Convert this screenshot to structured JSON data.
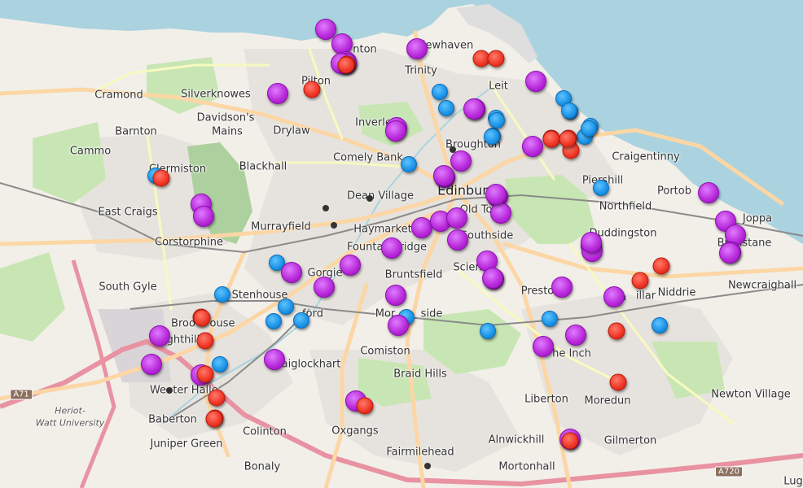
{
  "map": {
    "colors": {
      "land": "#f2efe9",
      "water": "#aad3df",
      "park": "#c8e6b4",
      "residential": "#e0dfdf",
      "primary_road": "#fcd6a4",
      "motorway": "#e892a2",
      "purple_marker": "#b626d8",
      "red_marker": "#ee3424",
      "blue_marker": "#1a92e6"
    },
    "places": [
      {
        "name": "Granton",
        "label": "nton"
      },
      {
        "name": "Newhaven",
        "label": "Newhaven"
      },
      {
        "name": "Cramond",
        "label": "Cramond"
      },
      {
        "name": "Silverknowes",
        "label": "Silverknowes"
      },
      {
        "name": "Pilton",
        "label": "Pilton"
      },
      {
        "name": "Trinity",
        "label": "Trinity"
      },
      {
        "name": "Leith",
        "label": "Leit"
      },
      {
        "name": "Davidson's Mains",
        "label": "Davidson's"
      },
      {
        "name": "Davidson's Mains 2",
        "label": "Mains"
      },
      {
        "name": "Barnton",
        "label": "Barnton"
      },
      {
        "name": "Drylaw",
        "label": "Drylaw"
      },
      {
        "name": "Inverleith",
        "label": "Inverleith"
      },
      {
        "name": "Cammo",
        "label": "Cammo"
      },
      {
        "name": "Broughton",
        "label": "Broughton"
      },
      {
        "name": "Craigentinny",
        "label": "Craigentinny"
      },
      {
        "name": "Comely Bank",
        "label": "Comely Bank"
      },
      {
        "name": "Clermiston",
        "label": "Clermiston"
      },
      {
        "name": "Blackhall",
        "label": "Blackhall"
      },
      {
        "name": "Piershill",
        "label": "Piershill"
      },
      {
        "name": "Dean Village",
        "label": "Dean Village"
      },
      {
        "name": "Edinburgh",
        "label": "Edinburgh"
      },
      {
        "name": "Portobello",
        "label": "Portob"
      },
      {
        "name": "Northfield",
        "label": "Northfield"
      },
      {
        "name": "Old Town",
        "label": "Old Town"
      },
      {
        "name": "East Craigs",
        "label": "East Craigs"
      },
      {
        "name": "Murrayfield",
        "label": "Murrayfield"
      },
      {
        "name": "Haymarket",
        "label": "Haymarket"
      },
      {
        "name": "Joppa",
        "label": "Joppa"
      },
      {
        "name": "Southside",
        "label": "Southside"
      },
      {
        "name": "Duddingston",
        "label": "Duddingston"
      },
      {
        "name": "Corstorphine",
        "label": "Corstorphine"
      },
      {
        "name": "Fountainbridge",
        "label": "Fountainbridge"
      },
      {
        "name": "Brunstane",
        "label": "Brunstane"
      },
      {
        "name": "Sciennes",
        "label": "Scien"
      },
      {
        "name": "Bruntsfield",
        "label": "Bruntsfield"
      },
      {
        "name": "Gorgie",
        "label": "Gorgie"
      },
      {
        "name": "Newcraighall",
        "label": "Newcraighall"
      },
      {
        "name": "South Gyle",
        "label": "South Gyle"
      },
      {
        "name": "Stenhouse",
        "label": "Stenhouse"
      },
      {
        "name": "Prestonfield",
        "label": "Presto"
      },
      {
        "name": "Craigmillar",
        "label": "Cra"
      },
      {
        "name": "Craigmillar 2",
        "label": "illar"
      },
      {
        "name": "Niddrie",
        "label": "Niddrie"
      },
      {
        "name": "Slateford",
        "label": "ford"
      },
      {
        "name": "Morningside",
        "label": "Mor"
      },
      {
        "name": "Morningside 2",
        "label": "side"
      },
      {
        "name": "Broomhouse",
        "label": "Broo"
      },
      {
        "name": "Broomhouse 2",
        "label": "ouse"
      },
      {
        "name": "Sighthill",
        "label": "Sighthill"
      },
      {
        "name": "Comiston",
        "label": "Comiston"
      },
      {
        "name": "The Inch",
        "label": "he Inch"
      },
      {
        "name": "Craiglockhart",
        "label": "aiglockhart"
      },
      {
        "name": "Braid Hills",
        "label": "Braid Hills"
      },
      {
        "name": "Wester Hailes",
        "label": "We"
      },
      {
        "name": "Wester Hailes 2",
        "label": "ter Halle"
      },
      {
        "name": "Liberton",
        "label": "Liberton"
      },
      {
        "name": "Moredun",
        "label": "Moredun"
      },
      {
        "name": "Newton Village",
        "label": "Newton Village"
      },
      {
        "name": "Heriot-Watt",
        "label": "Heriot-"
      },
      {
        "name": "Heriot-Watt 2",
        "label": "Watt University"
      },
      {
        "name": "Baberton",
        "label": "Baberton"
      },
      {
        "name": "Colinton",
        "label": "Colinton"
      },
      {
        "name": "Oxgangs",
        "label": "Oxgangs"
      },
      {
        "name": "Juniper Green",
        "label": "Juniper Green"
      },
      {
        "name": "Alnwickhill",
        "label": "Alnwickhill"
      },
      {
        "name": "Gilmerton",
        "label": "Gilmerton"
      },
      {
        "name": "Fairmilehead",
        "label": "Fairmilehead"
      },
      {
        "name": "Bonaly",
        "label": "Bonaly"
      },
      {
        "name": "Mortonhall",
        "label": "Mortonhall"
      },
      {
        "name": "Lugton",
        "label": "Lug"
      }
    ],
    "road_shields": [
      {
        "label": "A71"
      },
      {
        "label": "A720"
      }
    ],
    "markers": {
      "purple": 52,
      "red": 24,
      "blue": 25
    }
  }
}
